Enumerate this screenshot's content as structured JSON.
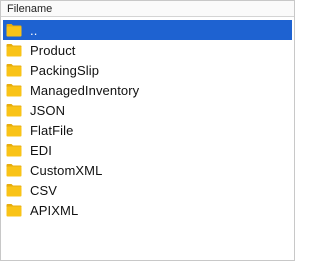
{
  "list": {
    "column_header": "Filename",
    "selected_index": 0,
    "items": [
      {
        "label": "..",
        "icon": "folder-icon"
      },
      {
        "label": "Product",
        "icon": "folder-icon"
      },
      {
        "label": "PackingSlip",
        "icon": "folder-icon"
      },
      {
        "label": "ManagedInventory",
        "icon": "folder-icon"
      },
      {
        "label": "JSON",
        "icon": "folder-icon"
      },
      {
        "label": "FlatFile",
        "icon": "folder-icon"
      },
      {
        "label": "EDI",
        "icon": "folder-icon"
      },
      {
        "label": "CustomXML",
        "icon": "folder-icon"
      },
      {
        "label": "CSV",
        "icon": "folder-icon"
      },
      {
        "label": "APIXML",
        "icon": "folder-icon"
      }
    ]
  },
  "colors": {
    "selection": "#1e62d1",
    "folder_body": "#f9c317",
    "folder_tab": "#e7ad0c"
  }
}
